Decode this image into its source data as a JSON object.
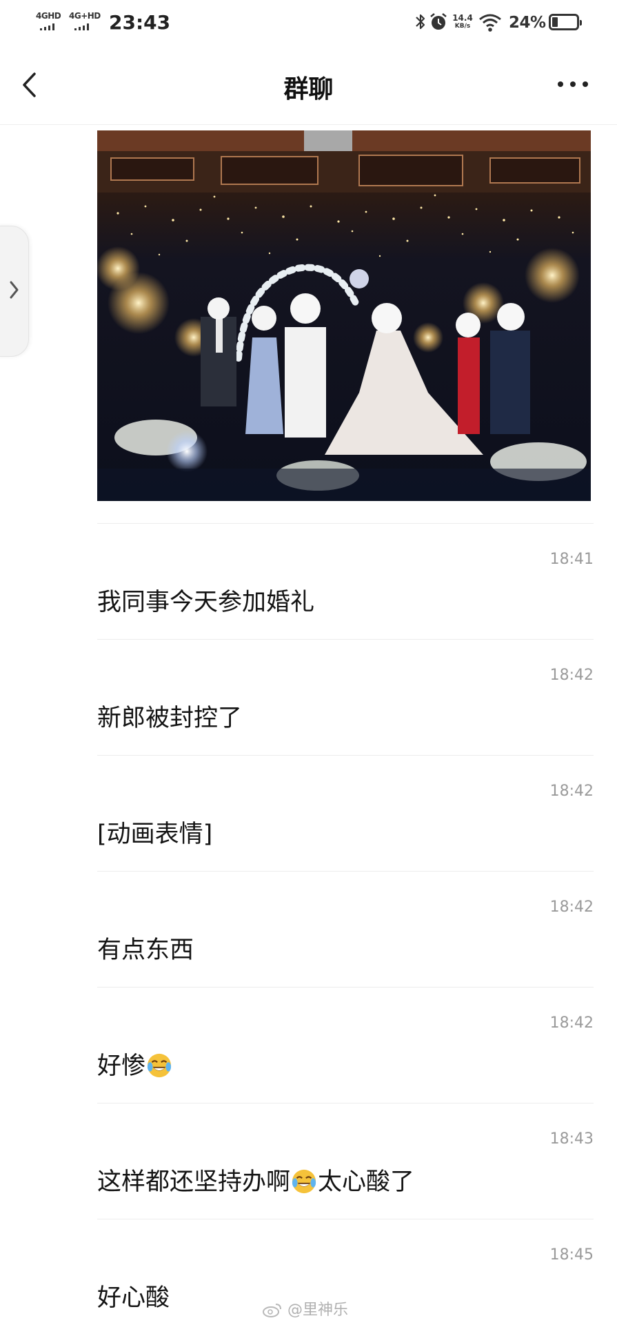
{
  "status_bar": {
    "signal1_label": "4GHD",
    "signal2_label": "4G+HD",
    "time": "23:43",
    "net_speed_value": "14.4",
    "net_speed_unit": "KB/s",
    "battery_text": "24%",
    "battery_level": 0.24,
    "icons": [
      "bluetooth-icon",
      "alarm-icon",
      "wifi-icon",
      "battery-icon"
    ]
  },
  "header": {
    "title": "群聊",
    "back_icon": "chevron-left-icon",
    "more_icon": "more-dots-icon"
  },
  "side_handle": {
    "icon": "chevron-right-icon"
  },
  "messages": [
    {
      "time": "18:41",
      "text": "我同事今天参加婚礼"
    },
    {
      "time": "18:42",
      "text": "新郎被封控了"
    },
    {
      "time": "18:42",
      "text": "[动画表情]"
    },
    {
      "time": "18:42",
      "text": "有点东西"
    },
    {
      "time": "18:42",
      "text": "好惨",
      "emoji": "crying-laughing-emoji"
    },
    {
      "time": "18:43",
      "text_before": "这样都还坚持办啊",
      "text_after": "太心酸了",
      "emoji": "crying-laughing-emoji"
    },
    {
      "time": "18:45",
      "text": "好心酸"
    }
  ],
  "watermark": "@里神乐",
  "colors": {
    "background": "#ffffff",
    "timestamp": "#9a9a9a",
    "separator": "#ececec",
    "emoji": "#f5c23a"
  }
}
